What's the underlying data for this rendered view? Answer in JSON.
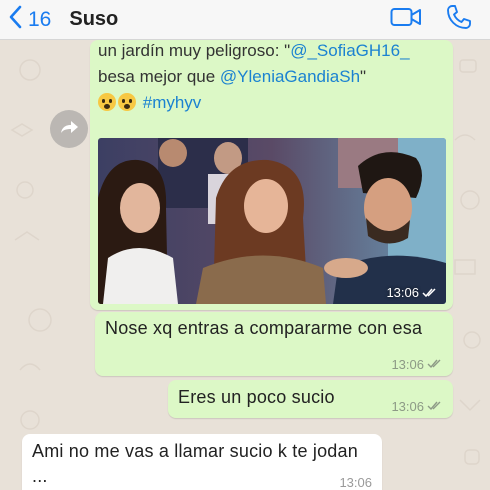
{
  "header": {
    "back_count": "16",
    "contact_name": "Suso",
    "icons": [
      "back-chevron-icon",
      "video-call-icon",
      "phone-call-icon"
    ],
    "accent_color": "#1a7cf0"
  },
  "media_message": {
    "text_line1_prefix": "un jardín muy peligroso: \"",
    "mention1": "@_SofiaGH16_",
    "text_line2_prefix": "besa mejor que ",
    "mention2": "@YleniaGandiaSh",
    "text_line2_suffix": "\"",
    "emojis": [
      "fearful-face-emoji",
      "fearful-face-emoji"
    ],
    "hashtag": "#myhyv",
    "time": "13:06",
    "status_icon": "double-check-icon"
  },
  "messages": [
    {
      "direction": "outgoing",
      "text": "Nose xq entras a compararme con esa",
      "time": "13:06",
      "status_icon": "double-check-icon"
    },
    {
      "direction": "outgoing",
      "text": "Eres un poco sucio",
      "time": "13:06",
      "status_icon": "double-check-icon"
    },
    {
      "direction": "incoming",
      "text": "Ami no me vas a llamar sucio k te jodan ...",
      "time": "13:06"
    }
  ],
  "colors": {
    "outgoing_bubble": "#dcf8c6",
    "incoming_bubble": "#ffffff",
    "chat_background": "#e8e1d8",
    "link": "#1b82d1"
  }
}
